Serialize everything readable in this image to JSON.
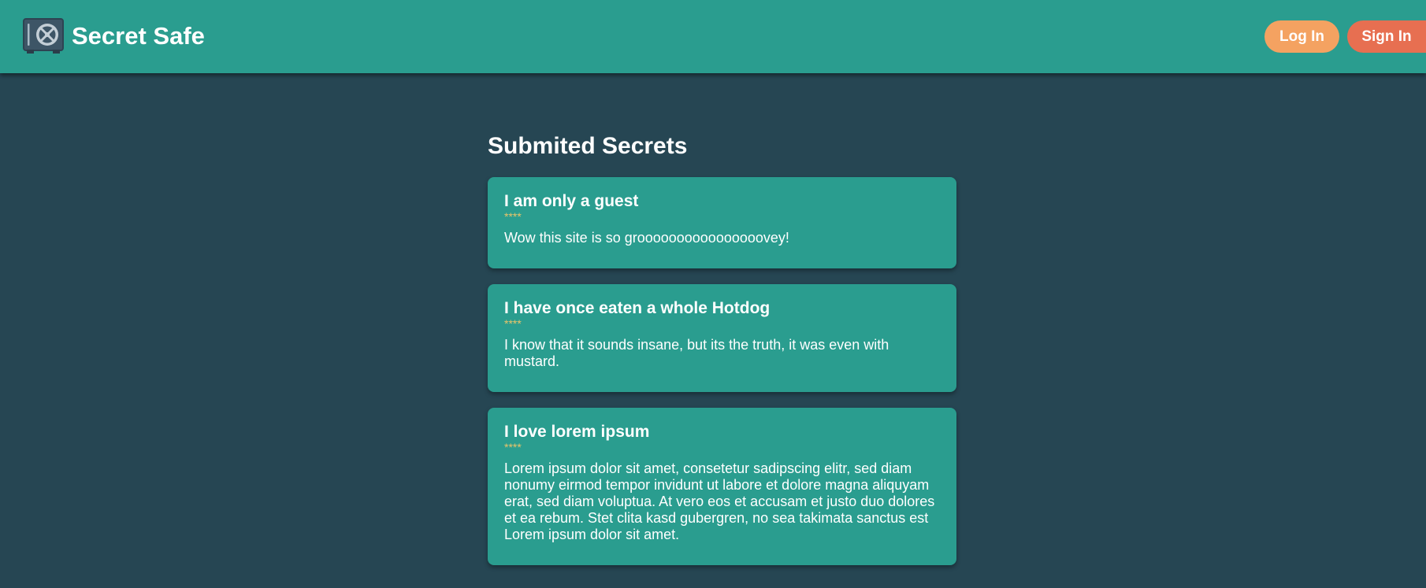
{
  "app": {
    "title": "Secret Safe",
    "logo_icon": "safe-icon"
  },
  "nav": {
    "login_label": "Log In",
    "signin_label": "Sign In"
  },
  "colors": {
    "background": "#264653",
    "primary": "#2a9d8f",
    "login_button": "#f4a261",
    "signin_button": "#e76f51",
    "author_text": "#e9c46a",
    "text": "#ffffff"
  },
  "main": {
    "heading": "Submited Secrets",
    "secrets": [
      {
        "title": "I am only a guest",
        "author": "****",
        "text": "Wow this site is so groooooooooooooooovey!"
      },
      {
        "title": "I have once eaten a whole Hotdog",
        "author": "****",
        "text": "I know that it sounds insane, but its the truth, it was even with mustard."
      },
      {
        "title": "I love lorem ipsum",
        "author": "****",
        "text": "Lorem ipsum dolor sit amet, consetetur sadipscing elitr, sed diam nonumy eirmod tempor invidunt ut labore et dolore magna aliquyam erat, sed diam voluptua. At vero eos et accusam et justo duo dolores et ea rebum. Stet clita kasd gubergren, no sea takimata sanctus est Lorem ipsum dolor sit amet."
      }
    ]
  }
}
